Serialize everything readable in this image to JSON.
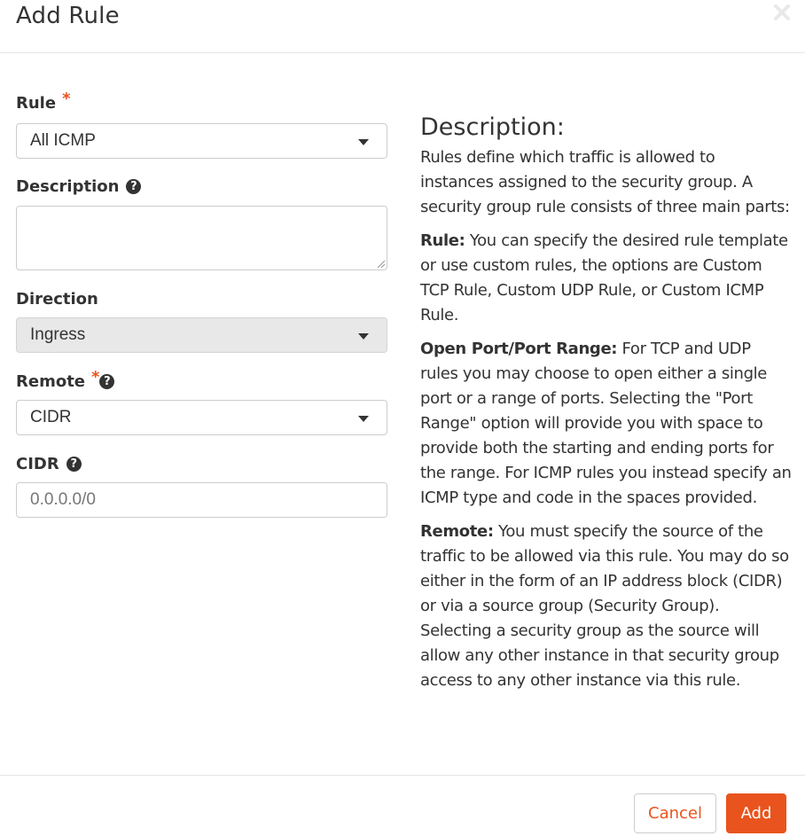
{
  "modal": {
    "title": "Add Rule",
    "close_icon": "close-icon"
  },
  "form": {
    "rule": {
      "label": "Rule",
      "required_mark": "*",
      "value": "All ICMP"
    },
    "description": {
      "label": "Description",
      "help_glyph": "?",
      "value": ""
    },
    "direction": {
      "label": "Direction",
      "value": "Ingress"
    },
    "remote": {
      "label": "Remote",
      "required_mark": "*",
      "help_glyph": "?",
      "value": "CIDR"
    },
    "cidr": {
      "label": "CIDR",
      "help_glyph": "?",
      "placeholder": "0.0.0.0/0"
    }
  },
  "help_panel": {
    "title": "Description:",
    "intro": "Rules define which traffic is allowed to instances assigned to the security group. A security group rule consists of three main parts:",
    "sections": [
      {
        "term": "Rule:",
        "text": " You can specify the desired rule template or use custom rules, the options are Custom TCP Rule, Custom UDP Rule, or Custom ICMP Rule."
      },
      {
        "term": "Open Port/Port Range:",
        "text": " For TCP and UDP rules you may choose to open either a single port or a range of ports. Selecting the \"Port Range\" option will provide you with space to provide both the starting and ending ports for the range. For ICMP rules you instead specify an ICMP type and code in the spaces provided."
      },
      {
        "term": "Remote:",
        "text": " You must specify the source of the traffic to be allowed via this rule. You may do so either in the form of an IP address block (CIDR) or via a source group (Security Group). Selecting a security group as the source will allow any other instance in that security group access to any other instance via this rule."
      }
    ]
  },
  "footer": {
    "cancel_label": "Cancel",
    "add_label": "Add"
  },
  "colors": {
    "accent": "#e9531d",
    "text": "#333333",
    "border": "#cccccc",
    "disabled_bg": "#e8e8e8"
  }
}
